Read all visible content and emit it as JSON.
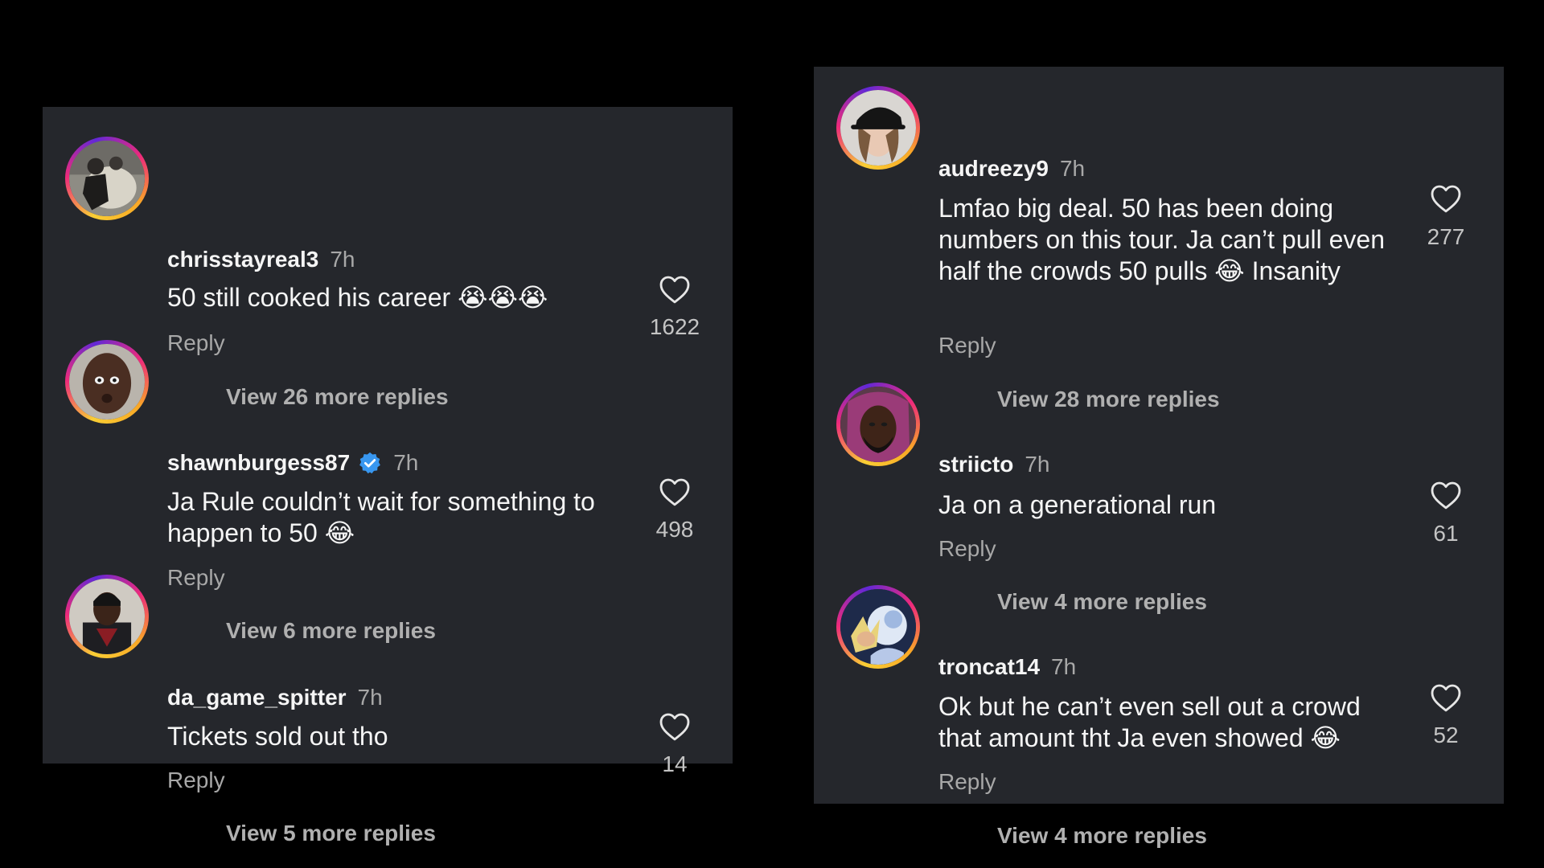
{
  "left_panel": {
    "comments": [
      {
        "username": "chrisstayreal3",
        "verified": false,
        "time": "7h",
        "text": "50 still cooked his career 😭😭😭",
        "reply_label": "Reply",
        "likes": "1622",
        "view_replies": "View 26 more replies"
      },
      {
        "username": "shawnburgess87",
        "verified": true,
        "time": "7h",
        "text": "Ja Rule couldn’t wait for something to happen to 50 😂",
        "reply_label": "Reply",
        "likes": "498",
        "view_replies": "View 6 more replies"
      },
      {
        "username": "da_game_spitter",
        "verified": false,
        "time": "7h",
        "text": "Tickets sold out tho",
        "reply_label": "Reply",
        "likes": "14",
        "view_replies": "View 5 more replies"
      }
    ]
  },
  "right_panel": {
    "comments": [
      {
        "username": "audreezy9",
        "verified": false,
        "time": "7h",
        "text": "Lmfao big deal. 50 has been doing numbers on this tour. Ja can’t pull even half the crowds 50 pulls 😂 Insanity",
        "reply_label": "Reply",
        "likes": "277",
        "view_replies": "View 28 more replies"
      },
      {
        "username": "striicto",
        "verified": false,
        "time": "7h",
        "text": "Ja on a generational run",
        "reply_label": "Reply",
        "likes": "61",
        "view_replies": "View 4 more replies"
      },
      {
        "username": "troncat14",
        "verified": false,
        "time": "7h",
        "text": "Ok but he can’t even sell out a crowd that amount tht Ja even showed 😂",
        "reply_label": "Reply",
        "likes": "52",
        "view_replies": "View 4 more replies"
      }
    ]
  },
  "icons": {
    "like": "heart-outline-icon",
    "verified": "verified-badge-icon"
  },
  "colors": {
    "background": "#000000",
    "panel": "#25272c",
    "text_primary": "#f5f5f5",
    "text_secondary": "#a8a8a8",
    "verified_blue": "#3897f0",
    "story_ring": [
      "#f9ce34",
      "#ee2a7b",
      "#6228d7"
    ]
  }
}
